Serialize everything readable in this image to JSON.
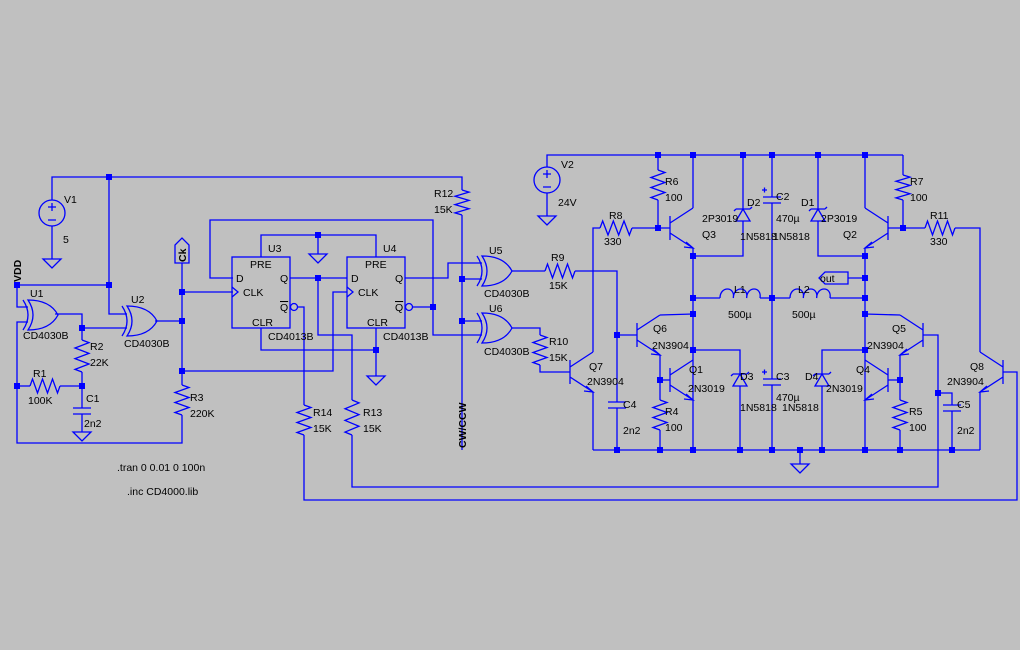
{
  "colors": {
    "background": "#c0c0c0",
    "wire": "#0000ff",
    "text": "#000000"
  },
  "nets": {
    "vdd": "VDD",
    "ck": "Ck",
    "cwccw": "CW/CCW",
    "out": "out"
  },
  "sources": {
    "V1": {
      "ref": "V1",
      "value": "5"
    },
    "V2": {
      "ref": "V2",
      "value": "24V"
    }
  },
  "gates": {
    "U1": {
      "ref": "U1",
      "model": "CD4030B"
    },
    "U2": {
      "ref": "U2",
      "model": "CD4030B"
    },
    "U5": {
      "ref": "U5",
      "model": "CD4030B"
    },
    "U6": {
      "ref": "U6",
      "model": "CD4030B"
    }
  },
  "flipflops": {
    "U3": {
      "ref": "U3",
      "model": "CD4013B"
    },
    "U4": {
      "ref": "U4",
      "model": "CD4013B"
    },
    "pins": {
      "pre": "PRE",
      "d": "D",
      "q": "Q",
      "clk": "CLK",
      "qbar": "Q",
      "clr": "CLR"
    }
  },
  "resistors": {
    "R1": {
      "ref": "R1",
      "value": "100K"
    },
    "R2": {
      "ref": "R2",
      "value": "22K"
    },
    "R3": {
      "ref": "R3",
      "value": "220K"
    },
    "R4": {
      "ref": "R4",
      "value": "100"
    },
    "R5": {
      "ref": "R5",
      "value": "100"
    },
    "R6": {
      "ref": "R6",
      "value": "100"
    },
    "R7": {
      "ref": "R7",
      "value": "100"
    },
    "R8": {
      "ref": "R8",
      "value": "330"
    },
    "R9": {
      "ref": "R9",
      "value": "15K"
    },
    "R10": {
      "ref": "R10",
      "value": "15K"
    },
    "R11": {
      "ref": "R11",
      "value": "330"
    },
    "R12": {
      "ref": "R12",
      "value": "15K"
    },
    "R13": {
      "ref": "R13",
      "value": "15K"
    },
    "R14": {
      "ref": "R14",
      "value": "15K"
    }
  },
  "capacitors": {
    "C1": {
      "ref": "C1",
      "value": "2n2"
    },
    "C2": {
      "ref": "C2",
      "value": "470µ"
    },
    "C3": {
      "ref": "C3",
      "value": "470µ"
    },
    "C4": {
      "ref": "C4",
      "value": "2n2"
    },
    "C5": {
      "ref": "C5",
      "value": "2n2"
    }
  },
  "inductors": {
    "L1": {
      "ref": "L1",
      "value": "500µ"
    },
    "L2": {
      "ref": "L2",
      "value": "500µ"
    }
  },
  "diodes": {
    "D1": {
      "ref": "D1",
      "model": "1N5818"
    },
    "D2": {
      "ref": "D2",
      "model": "1N5818"
    },
    "D3": {
      "ref": "D3",
      "model": "1N5818"
    },
    "D4": {
      "ref": "D4",
      "model": "1N5818"
    }
  },
  "transistors": {
    "Q1": {
      "ref": "Q1",
      "model": "2N3019"
    },
    "Q2": {
      "ref": "Q2",
      "model": "2P3019"
    },
    "Q3": {
      "ref": "Q3",
      "model": "2P3019"
    },
    "Q4": {
      "ref": "Q4",
      "model": "2N3019"
    },
    "Q5": {
      "ref": "Q5",
      "model": "2N3904"
    },
    "Q6": {
      "ref": "Q6",
      "model": "2N3904"
    },
    "Q7": {
      "ref": "Q7",
      "model": "2N3904"
    },
    "Q8": {
      "ref": "Q8",
      "model": "2N3904"
    }
  },
  "directives": [
    ".tran 0 0.01 0 100n",
    ".inc CD4000.lib"
  ]
}
